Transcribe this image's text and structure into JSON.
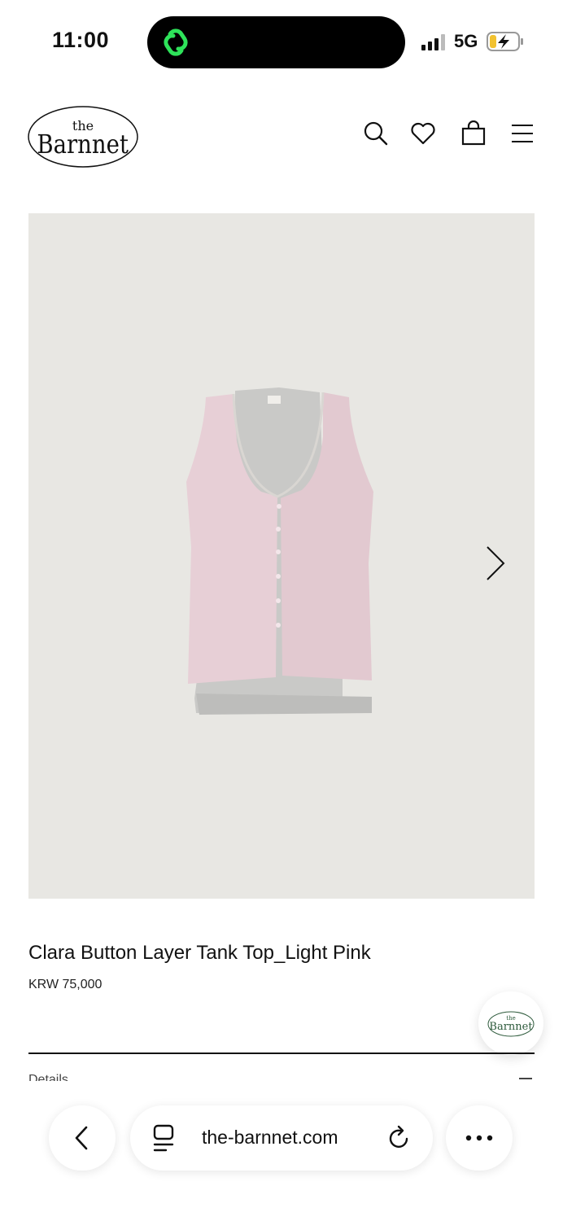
{
  "status_bar": {
    "time": "11:00",
    "network": "5G"
  },
  "header": {
    "logo_top": "the",
    "logo_main": "Barnnet",
    "icons": [
      "search-icon",
      "heart-icon",
      "bag-icon",
      "menu-icon"
    ]
  },
  "product": {
    "title": "Clara Button Layer Tank Top_Light Pink",
    "price": "KRW 75,000",
    "details_label": "Details"
  },
  "browser": {
    "url": "the-barnnet.com"
  },
  "colors": {
    "accent_green": "#2ee35a",
    "image_background": "#e8e7e3",
    "garment_pink": "#e7cfd6",
    "garment_grey": "#c9c9c7"
  }
}
